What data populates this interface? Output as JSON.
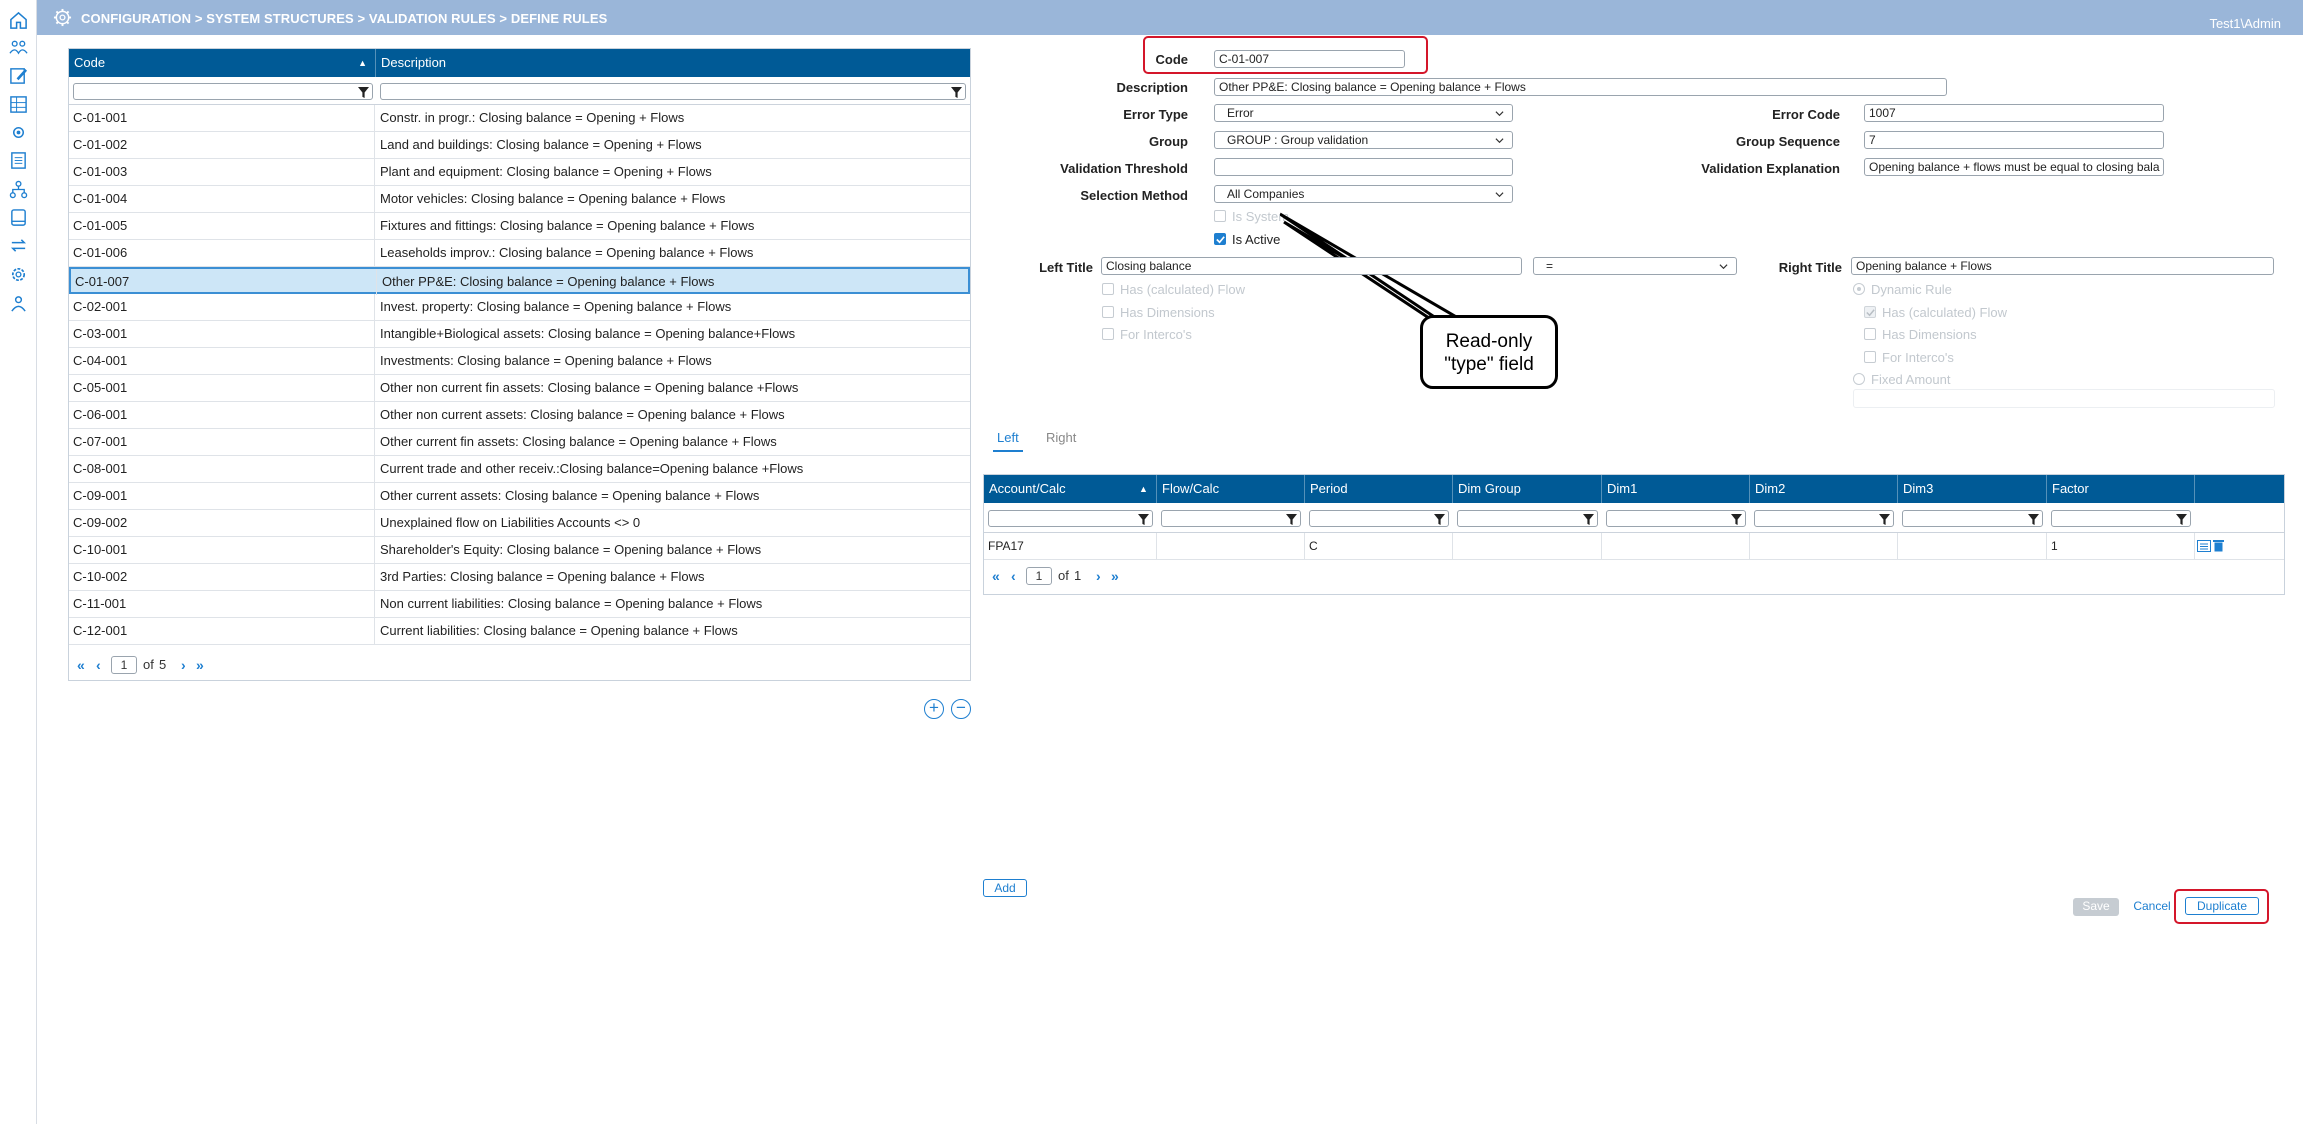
{
  "app": {
    "breadcrumb": "CONFIGURATION > SYSTEM STRUCTURES > VALIDATION RULES > DEFINE RULES",
    "user": "Test1\\Admin",
    "nav_icons": [
      "home-icon",
      "people-icon",
      "edit-icon",
      "sitemap-icon",
      "gears-icon",
      "document-icon",
      "hierarchy-icon",
      "book-icon",
      "swap-icon",
      "settings-icon",
      "users-icon"
    ]
  },
  "rules_grid": {
    "columns": [
      "Code",
      "Description"
    ],
    "rows": [
      {
        "code": "C-01-001",
        "description": "Constr. in progr.: Closing balance = Opening + Flows"
      },
      {
        "code": "C-01-002",
        "description": "Land and buildings: Closing balance = Opening + Flows"
      },
      {
        "code": "C-01-003",
        "description": "Plant and equipment: Closing balance = Opening + Flows"
      },
      {
        "code": "C-01-004",
        "description": "Motor vehicles: Closing balance = Opening balance + Flows"
      },
      {
        "code": "C-01-005",
        "description": "Fixtures and fittings: Closing balance = Opening balance + Flows"
      },
      {
        "code": "C-01-006",
        "description": "Leaseholds improv.: Closing balance = Opening balance + Flows"
      },
      {
        "code": "C-01-007",
        "description": "Other PP&E: Closing balance = Opening balance + Flows"
      },
      {
        "code": "C-02-001",
        "description": "Invest. property: Closing balance = Opening balance + Flows"
      },
      {
        "code": "C-03-001",
        "description": "Intangible+Biological assets: Closing balance = Opening balance+Flows"
      },
      {
        "code": "C-04-001",
        "description": "Investments: Closing balance = Opening balance + Flows"
      },
      {
        "code": "C-05-001",
        "description": "Other non current fin assets: Closing balance = Opening balance +Flows"
      },
      {
        "code": "C-06-001",
        "description": "Other non current assets: Closing balance = Opening balance + Flows"
      },
      {
        "code": "C-07-001",
        "description": "Other current fin assets: Closing balance = Opening balance + Flows"
      },
      {
        "code": "C-08-001",
        "description": "Current trade and other receiv.:Closing balance=Opening balance +Flows"
      },
      {
        "code": "C-09-001",
        "description": "Other current assets: Closing balance = Opening balance + Flows"
      },
      {
        "code": "C-09-002",
        "description": "Unexplained flow on Liabilities Accounts <> 0"
      },
      {
        "code": "C-10-001",
        "description": "Shareholder's Equity: Closing balance = Opening balance + Flows"
      },
      {
        "code": "C-10-002",
        "description": "3rd Parties: Closing balance = Opening balance + Flows"
      },
      {
        "code": "C-11-001",
        "description": "Non current liabilities: Closing balance = Opening balance + Flows"
      },
      {
        "code": "C-12-001",
        "description": "Current liabilities: Closing balance = Opening balance + Flows"
      }
    ],
    "selected_code": "C-01-007",
    "pager": {
      "page": "1",
      "of_label": "of",
      "total": "5"
    }
  },
  "form": {
    "code_label": "Code",
    "code_value": "C-01-007",
    "description_label": "Description",
    "description_value": "Other PP&E: Closing balance = Opening balance + Flows",
    "error_type_label": "Error Type",
    "error_type_value": "Error",
    "group_label": "Group",
    "group_value": "GROUP : Group validation",
    "validation_threshold_label": "Validation Threshold",
    "validation_threshold_value": "",
    "selection_method_label": "Selection Method",
    "selection_method_value": "All Companies",
    "error_code_label": "Error Code",
    "error_code_value": "1007",
    "group_sequence_label": "Group Sequence",
    "group_sequence_value": "7",
    "validation_explanation_label": "Validation Explanation",
    "validation_explanation_value": "Opening balance + flows must be equal to closing bala",
    "is_system_label": "Is System",
    "is_system_checked": false,
    "is_active_label": "Is Active",
    "is_active_checked": true,
    "left_title_label": "Left Title",
    "left_title_value": "Closing balance",
    "operator_value": "=",
    "right_title_label": "Right Title",
    "right_title_value": "Opening balance + Flows",
    "left_options": [
      "Has (calculated) Flow",
      "Has Dimensions",
      "For Interco's"
    ],
    "right_options": [
      {
        "label": "Dynamic Rule",
        "kind": "radio",
        "checked": true
      },
      {
        "label": "Has (calculated) Flow",
        "kind": "checkbox",
        "checked": true
      },
      {
        "label": "Has Dimensions",
        "kind": "checkbox",
        "checked": false
      },
      {
        "label": "For Interco's",
        "kind": "checkbox",
        "checked": false
      },
      {
        "label": "Fixed Amount",
        "kind": "radio",
        "checked": false
      }
    ]
  },
  "callout": {
    "line1": "Read-only",
    "line2": "\"type\" field"
  },
  "tabs": [
    "Left",
    "Right"
  ],
  "active_tab": "Left",
  "calc_grid": {
    "columns": [
      "Account/Calc",
      "Flow/Calc",
      "Period",
      "Dim Group",
      "Dim1",
      "Dim2",
      "Dim3",
      "Factor"
    ],
    "rows": [
      {
        "account": "FPA17",
        "flow": "",
        "period": "C",
        "dim_group": "",
        "dim1": "",
        "dim2": "",
        "dim3": "",
        "factor": "1"
      }
    ],
    "pager": {
      "page": "1",
      "of_label": "of",
      "total": "1"
    }
  },
  "buttons": {
    "add": "Add",
    "save": "Save",
    "cancel": "Cancel",
    "duplicate": "Duplicate"
  },
  "colors": {
    "header_bar": "#9ab6d9",
    "grid_header": "#005a96",
    "accent": "#1e7fd0",
    "highlight": "#d4162a",
    "selected_row": "#cde6f7"
  }
}
